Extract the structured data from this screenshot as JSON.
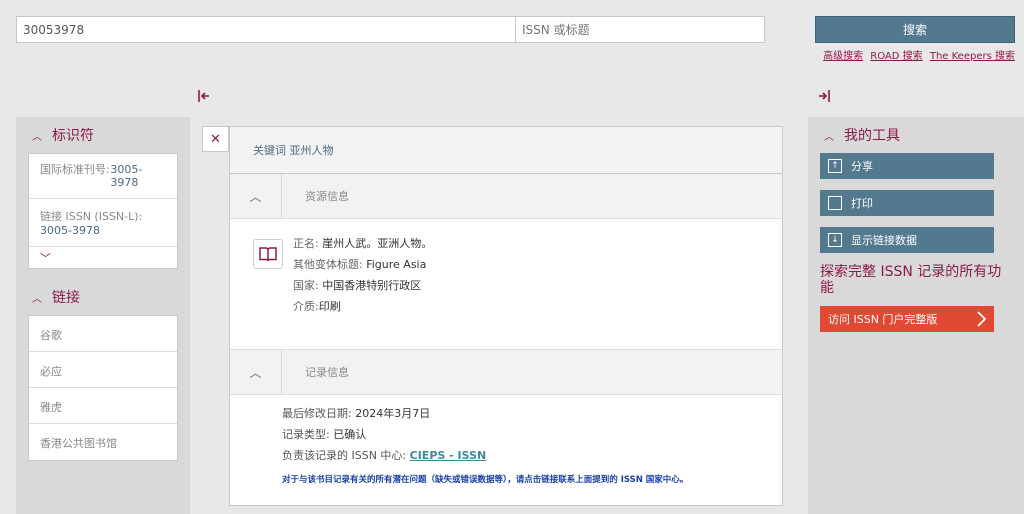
{
  "search": {
    "query_value": "30053978",
    "filter_placeholder": "ISSN 或标题",
    "button_label": "搜索",
    "links": [
      "高级搜索",
      "ROAD 搜索",
      "The Keepers 搜索"
    ]
  },
  "left": {
    "identifiers_title": "标识符",
    "issn_label": "国际标准刊号:",
    "issn_value": "3005-3978",
    "issnl_label": "链接 ISSN (ISSN-L):",
    "issnl_value": "3005-3978",
    "links_title": "链接",
    "links": [
      "谷歌",
      "必应",
      "雅虎",
      "香港公共图书馆"
    ]
  },
  "main": {
    "keyword_title": "关键词 亚州人物",
    "resource_section": "资源信息",
    "resource": {
      "title_label": "正名:",
      "title_value": "崖州人武。亚洲人物。",
      "variant_label": "其他变体标题:",
      "variant_value": "Figure Asia",
      "country_label": "国家:",
      "country_value": "中国香港特别行政区",
      "medium_label": "介质:",
      "medium_value": "印刷"
    },
    "record_section": "记录信息",
    "record": {
      "modified_label": "最后修改日期:",
      "modified_value": "2024年3月7日",
      "type_label": "记录类型:",
      "type_value": "已确认",
      "center_label": "负责该记录的 ISSN 中心:",
      "center_value": "CIEPS - ISSN",
      "note": "对于与该书目记录有关的所有潜在问题（缺失或错误数据等），请点击链接联系上面提到的 ISSN 国家中心。"
    }
  },
  "right": {
    "tools_title": "我的工具",
    "share": "分享",
    "print": "打印",
    "linked_data": "显示链接数据",
    "explore": "探索完整 ISSN 记录的所有功能",
    "portal": "访问 ISSN 门户完整版"
  },
  "colors": {
    "brand": "#8b1a4a",
    "button": "#53798f",
    "portal": "#e04a33"
  }
}
